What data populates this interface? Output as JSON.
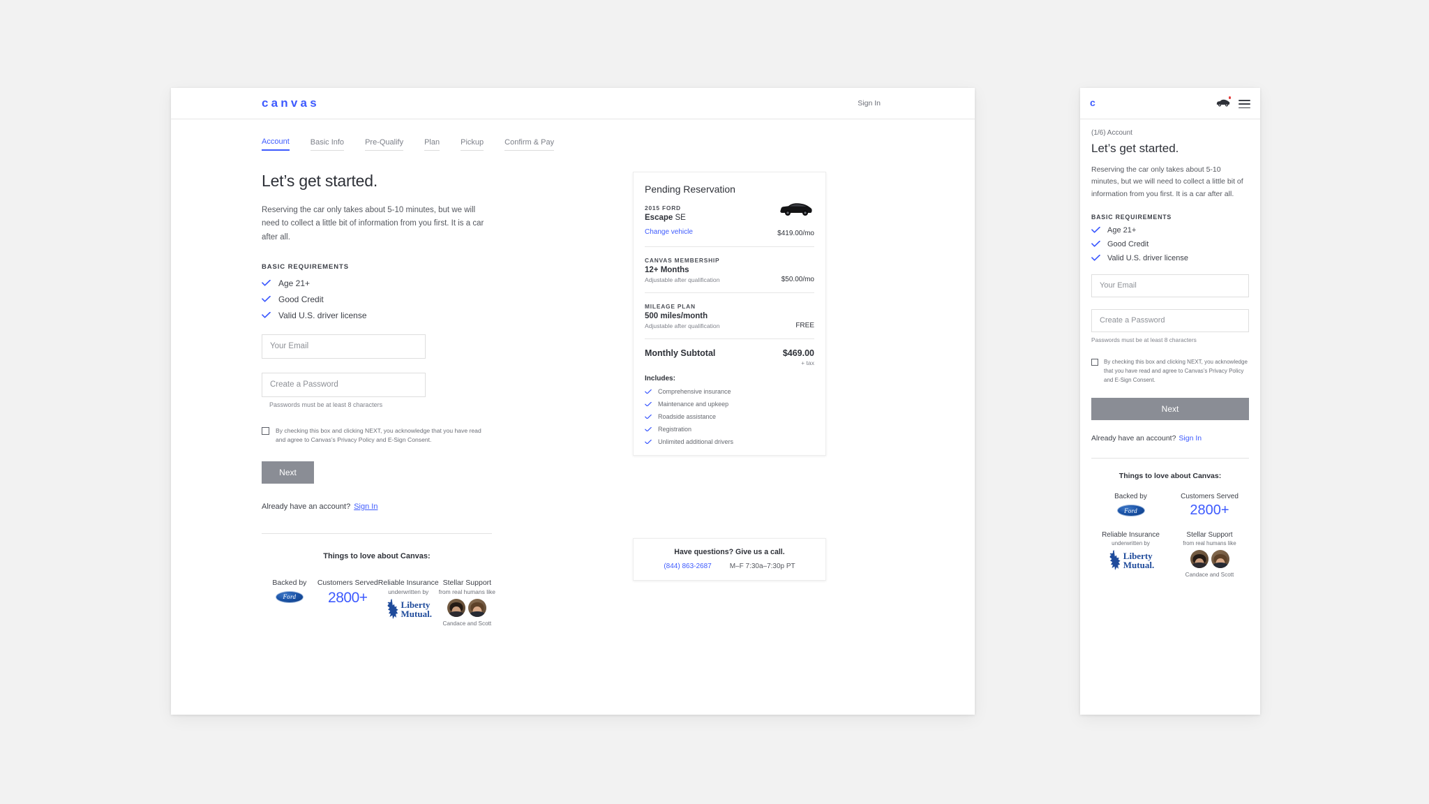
{
  "desktop": {
    "brand": "canvas",
    "header_signin": "Sign In",
    "tabs": [
      {
        "label": "Account",
        "active": true
      },
      {
        "label": "Basic Info",
        "active": false
      },
      {
        "label": "Pre-Qualify",
        "active": false
      },
      {
        "label": "Plan",
        "active": false
      },
      {
        "label": "Pickup",
        "active": false
      },
      {
        "label": "Confirm & Pay",
        "active": false
      }
    ],
    "heading": "Let’s get started.",
    "lede": "Reserving the car only takes about 5-10 minutes, but we will need to collect a little bit of information from you first. It is a car after all.",
    "requirements_label": "BASIC REQUIREMENTS",
    "requirements": [
      "Age 21+",
      "Good Credit",
      "Valid U.S. driver license"
    ],
    "email_placeholder": "Your Email",
    "email_value": "",
    "password_placeholder": "Create a Password",
    "password_value": "",
    "password_hint": "Passwords must be at least 8 characters",
    "consent_text": "By checking this box and clicking NEXT, you acknowledge that you have read and agree to Canvas’s Privacy Policy and E-Sign Consent.",
    "next_label": "Next",
    "already_text": "Already have an account?",
    "already_link": "Sign In",
    "love_title": "Things to love about Canvas:",
    "love": [
      {
        "cap": "Backed by",
        "sub": "",
        "value": "",
        "icon": "ford-logo"
      },
      {
        "cap": "Customers Served",
        "sub": "",
        "value": "2800+",
        "icon": ""
      },
      {
        "cap": "Reliable Insurance",
        "sub": "underwritten by",
        "value": "",
        "icon": "liberty-mutual-logo"
      },
      {
        "cap": "Stellar Support",
        "sub": "from real humans like",
        "value": "",
        "icon": "avatars",
        "caption": "Candace and Scott"
      }
    ]
  },
  "reservation": {
    "title": "Pending Reservation",
    "vehicle_kicker": "2015 FORD",
    "vehicle_model": "Escape",
    "vehicle_trim": "SE",
    "change_vehicle": "Change vehicle",
    "vehicle_price": "$419.00/mo",
    "membership_kicker": "CANVAS MEMBERSHIP",
    "membership_value": "12+ Months",
    "membership_note": "Adjustable after qualification",
    "membership_price": "$50.00/mo",
    "mileage_kicker": "MILEAGE PLAN",
    "mileage_value": "500 miles/month",
    "mileage_note": "Adjustable after qualification",
    "mileage_price": "FREE",
    "subtotal_label": "Monthly Subtotal",
    "subtotal_value": "$469.00",
    "tax_note": "+ tax",
    "includes_label": "Includes:",
    "includes": [
      "Comprehensive insurance",
      "Maintenance and upkeep",
      "Roadside assistance",
      "Registration",
      "Unlimited additional drivers"
    ]
  },
  "call_card": {
    "title": "Have questions? Give us a call.",
    "phone": "(844) 863-2687",
    "hours": "M–F 7:30a–7:30p PT"
  },
  "mobile": {
    "brand": "c",
    "step": "(1/6) Account",
    "heading": "Let’s get started.",
    "lede": "Reserving the car only takes about 5-10 minutes, but we will need to collect a little bit of information from you first. It is a car after all.",
    "requirements_label": "BASIC REQUIREMENTS",
    "requirements": [
      "Age 21+",
      "Good Credit",
      "Valid U.S. driver license"
    ],
    "email_placeholder": "Your Email",
    "email_value": "",
    "password_placeholder": "Create a Password",
    "password_value": "",
    "password_hint": "Passwords must be at least 8 characters",
    "consent_text": "By checking this box and clicking NEXT, you acknowledge that you have read and agree to Canvas’s Privacy Policy and E-Sign Consent.",
    "next_label": "Next",
    "already_text": "Already have an account?",
    "already_link": "Sign In",
    "love_title": "Things to love about Canvas:",
    "love_row1": [
      {
        "cap": "Backed by",
        "sub": "",
        "value": ""
      },
      {
        "cap": "Customers Served",
        "sub": "",
        "value": "2800+"
      }
    ],
    "love_row2": [
      {
        "cap": "Reliable Insurance",
        "sub": "underwritten by",
        "value": ""
      },
      {
        "cap": "Stellar Support",
        "sub": "from real humans like",
        "value": "",
        "caption": "Candace and Scott"
      }
    ]
  },
  "colors": {
    "brand_blue": "#3d5afe",
    "text_dark": "#2e3138",
    "text_muted": "#6c6f77",
    "button_grey": "#8a8d95",
    "page_bg": "#f2f2f2"
  }
}
